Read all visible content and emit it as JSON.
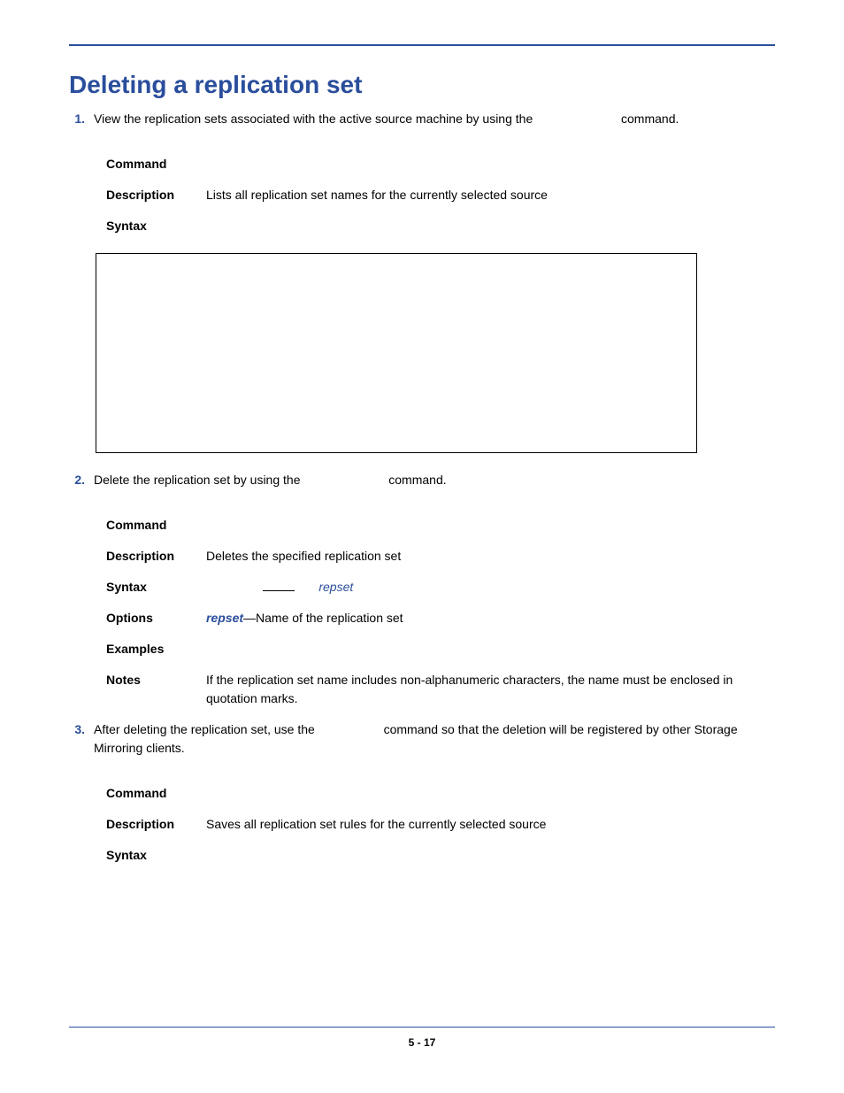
{
  "heading": "Deleting a replication set",
  "steps": {
    "s1": {
      "num": "1.",
      "text_before": "View the replication sets associated with the active source machine by using the",
      "text_after": "command."
    },
    "s2": {
      "num": "2.",
      "text_before": "Delete the replication set by using the",
      "text_after": "command."
    },
    "s3": {
      "num": "3.",
      "text_before": "After deleting the replication set, use the",
      "text_mid": "command so that the deletion will be registered by other Storage Mirroring clients."
    }
  },
  "labels": {
    "command": "Command",
    "description": "Description",
    "syntax": "Syntax",
    "options": "Options",
    "examples": "Examples",
    "notes": "Notes"
  },
  "block1": {
    "description": "Lists all replication set names for the currently selected source"
  },
  "block2": {
    "description": "Deletes the specified replication set",
    "syntax_italic": "repset",
    "options_italic": "repset",
    "options_rest": "—Name of the replication set",
    "notes": "If the replication set name includes non-alphanumeric characters, the name must be enclosed in quotation marks."
  },
  "block3": {
    "description": "Saves all replication set rules for the currently selected source"
  },
  "footer": "5 - 17"
}
